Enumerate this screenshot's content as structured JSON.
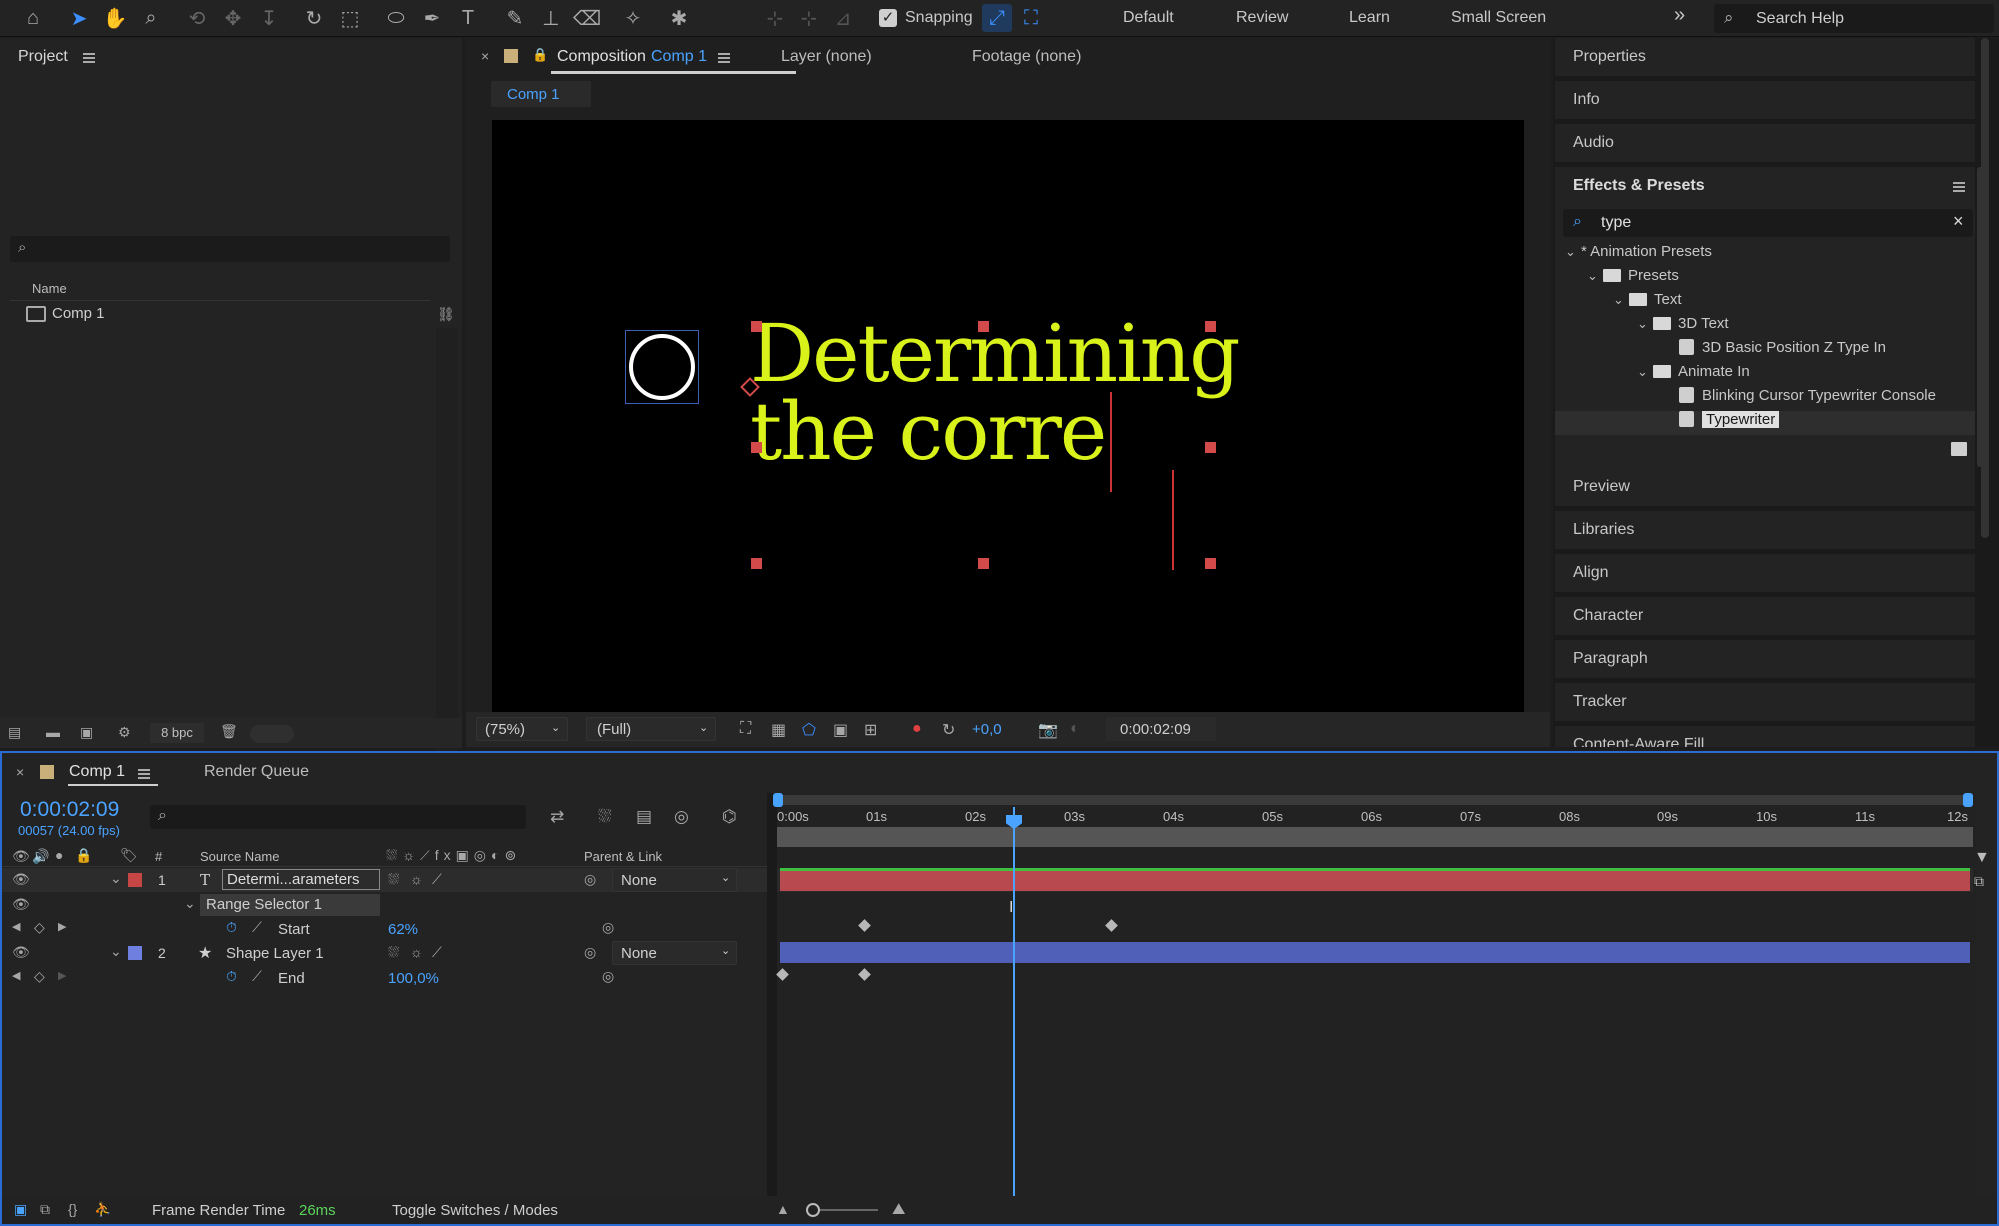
{
  "toolbar": {
    "snapping_label": "Snapping",
    "workspaces": [
      "Default",
      "Review",
      "Learn",
      "Small Screen"
    ],
    "more_label": "»",
    "search_placeholder": "Search Help"
  },
  "project": {
    "title": "Project",
    "search_value": "",
    "column_name": "Name",
    "items": [
      {
        "name": "Comp 1"
      }
    ],
    "bpc_label": "8 bpc"
  },
  "composition": {
    "tab_prefix": "Composition",
    "tab_name": "Comp 1",
    "layer_tab": "Layer (none)",
    "footage_tab": "Footage (none)",
    "breadcrumb": "Comp 1",
    "text_line1": "Determining",
    "text_line2": "the corre",
    "text_color": "#d9f21a",
    "zoom": "(75%)",
    "resolution": "(Full)",
    "exposure": "+0,0",
    "timecode": "0:00:02:09"
  },
  "right_panels": {
    "top": [
      "Properties",
      "Info",
      "Audio"
    ],
    "effects_title": "Effects & Presets",
    "effects_search": "type",
    "tree": [
      {
        "label": "* Animation Presets",
        "kind": "root",
        "indent": 0
      },
      {
        "label": "Presets",
        "kind": "folder",
        "indent": 1
      },
      {
        "label": "Text",
        "kind": "folder",
        "indent": 2
      },
      {
        "label": "3D Text",
        "kind": "folder",
        "indent": 3
      },
      {
        "label": "3D Basic Position Z Type In",
        "kind": "preset",
        "indent": 4
      },
      {
        "label": "Animate In",
        "kind": "folder",
        "indent": 3
      },
      {
        "label": "Blinking Cursor Typewriter Console",
        "kind": "preset",
        "indent": 4
      },
      {
        "label": "Typewriter",
        "kind": "preset",
        "indent": 4,
        "selected": true
      }
    ],
    "bottom": [
      "Preview",
      "Libraries",
      "Align",
      "Character",
      "Paragraph",
      "Tracker",
      "Content-Aware Fill"
    ]
  },
  "timeline": {
    "tab_name": "Comp 1",
    "render_queue": "Render Queue",
    "current_time": "0:00:02:09",
    "frame_info": "00057 (24.00 fps)",
    "col_number": "#",
    "col_source": "Source Name",
    "col_parent": "Parent & Link",
    "ruler": [
      "0:00s",
      "01s",
      "02s",
      "03s",
      "04s",
      "05s",
      "06s",
      "07s",
      "08s",
      "09s",
      "10s",
      "11s",
      "12s"
    ],
    "layers": [
      {
        "num": "1",
        "type_icon": "T",
        "name": "Determi...arameters",
        "color": "#c64545",
        "parent": "None",
        "bar_color": "#b8494e"
      },
      {
        "num": "2",
        "type_icon": "★",
        "name": "Shape Layer 1",
        "color": "#6f7fe0",
        "parent": "None",
        "bar_color": "#5060b8"
      }
    ],
    "range_selector": "Range Selector 1",
    "start_label": "Start",
    "start_value": "62%",
    "end_label": "End",
    "end_value": "100,0%",
    "footer_render_label": "Frame Render Time",
    "footer_render_value": "26ms",
    "footer_toggle": "Toggle Switches / Modes"
  }
}
